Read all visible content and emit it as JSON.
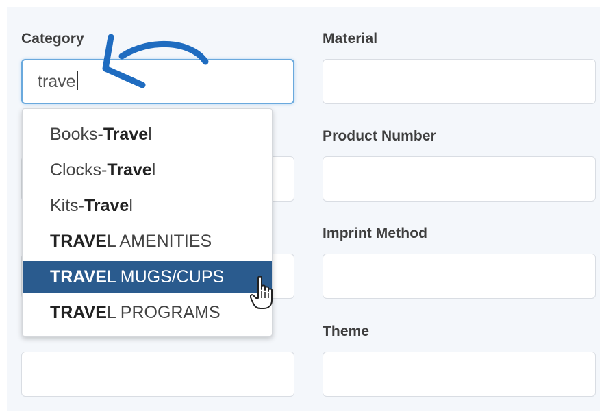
{
  "form": {
    "category": {
      "label": "Category",
      "value": "trave"
    },
    "material": {
      "label": "Material",
      "value": ""
    },
    "product_number": {
      "label": "Product Number",
      "value": ""
    },
    "imprint_method": {
      "label": "Imprint Method",
      "value": ""
    },
    "theme": {
      "label": "Theme",
      "value": ""
    }
  },
  "dropdown": {
    "options": [
      {
        "prefix": "Books-",
        "match": "Trave",
        "suffix": "l",
        "selected": false
      },
      {
        "prefix": "Clocks-",
        "match": "Trave",
        "suffix": "l",
        "selected": false
      },
      {
        "prefix": "Kits-",
        "match": "Trave",
        "suffix": "l",
        "selected": false
      },
      {
        "prefix": "",
        "match": "TRAVE",
        "suffix": "L AMENITIES",
        "selected": false
      },
      {
        "prefix": "",
        "match": "TRAVE",
        "suffix": "L MUGS/CUPS",
        "selected": true
      },
      {
        "prefix": "",
        "match": "TRAVE",
        "suffix": "L PROGRAMS",
        "selected": false
      }
    ]
  },
  "colors": {
    "panel_background": "#f4f7fb",
    "selected_option": "#2a5b8e",
    "annotation_arrow": "#1f6cc0",
    "active_field_border": "#6aa9dd"
  },
  "icons": {
    "annotation": "curved-arrow-icon",
    "pointer": "hand-cursor-icon"
  }
}
